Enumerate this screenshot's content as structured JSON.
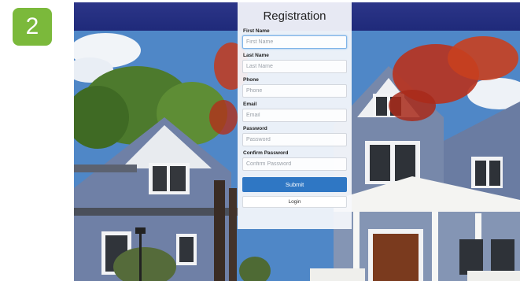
{
  "step_badge": {
    "number": "2",
    "color": "#7bb93b"
  },
  "header": {
    "bar_color": "#1f2a7a"
  },
  "form": {
    "title": "Registration",
    "fields": [
      {
        "label": "First Name",
        "placeholder": "First Name"
      },
      {
        "label": "Last Name",
        "placeholder": "Last Name"
      },
      {
        "label": "Phone",
        "placeholder": "Phone"
      },
      {
        "label": "Email",
        "placeholder": "Email"
      },
      {
        "label": "Password",
        "placeholder": "Password"
      },
      {
        "label": "Confirm Password",
        "placeholder": "Confirm Password"
      }
    ],
    "submit_label": "Submit",
    "login_label": "Login",
    "accent_color": "#2f77c4"
  }
}
